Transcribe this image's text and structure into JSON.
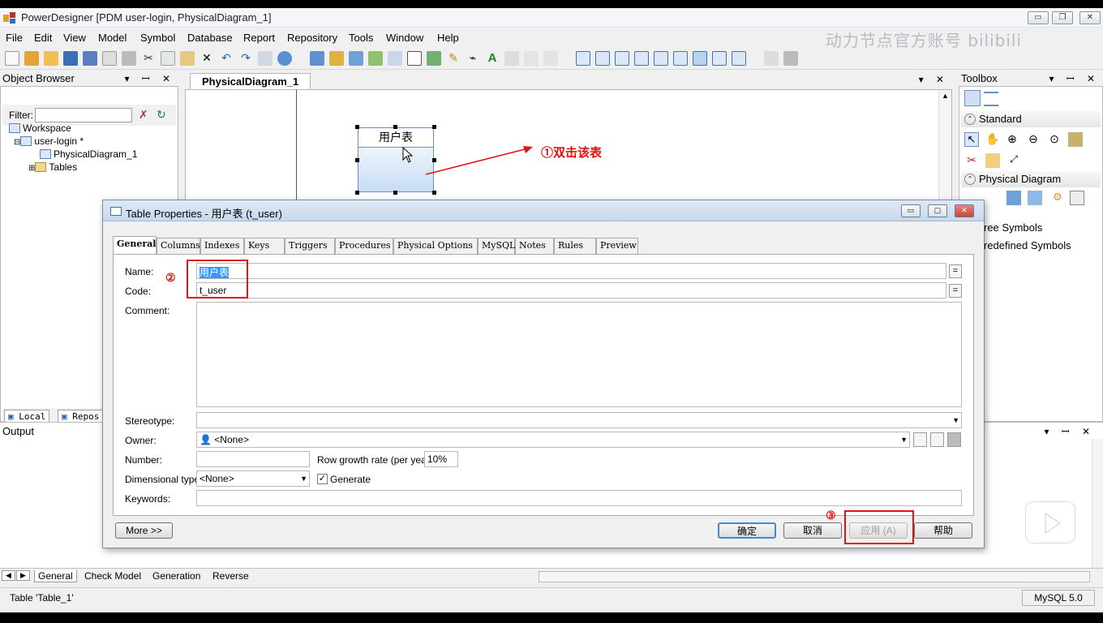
{
  "window": {
    "title": "PowerDesigner [PDM user-login, PhysicalDiagram_1]",
    "controls": [
      "▭",
      "❐",
      "✕"
    ]
  },
  "watermark": "动力节点官方账号 bilibili",
  "menu": [
    "File",
    "Edit",
    "View",
    "Model",
    "Symbol",
    "Database",
    "Report",
    "Repository",
    "Tools",
    "Window",
    "Help"
  ],
  "object_browser": {
    "title": "Object Browser",
    "filter_label": "Filter:",
    "tree": [
      "Workspace",
      "user-login *",
      "PhysicalDiagram_1",
      "Tables"
    ],
    "tabs": [
      "Local",
      "Repos"
    ]
  },
  "diagram": {
    "tab_label": "PhysicalDiagram_1",
    "table_symbol_name": "用户表",
    "annotation": "①双击该表"
  },
  "toolbox": {
    "title": "Toolbox",
    "sections": [
      "Standard",
      "Physical Diagram",
      "ree Symbols",
      "redefined Symbols"
    ]
  },
  "output": {
    "title": "Output",
    "tabs": [
      "General",
      "Check Model",
      "Generation",
      "Reverse"
    ]
  },
  "status": {
    "left": "Table 'Table_1'",
    "right": "MySQL 5.0"
  },
  "dialog": {
    "title": "Table Properties - 用户表 (t_user)",
    "tabs": [
      "General",
      "Columns",
      "Indexes",
      "Keys",
      "Triggers",
      "Procedures",
      "Physical Options",
      "MySQL",
      "Notes",
      "Rules",
      "Preview"
    ],
    "active_tab": "General",
    "labels": {
      "name": "Name:",
      "code": "Code:",
      "comment": "Comment:",
      "stereotype": "Stereotype:",
      "owner": "Owner:",
      "number": "Number:",
      "row_growth": "Row growth rate (per year):",
      "dimensional_type": "Dimensional type:",
      "generate": "Generate",
      "keywords": "Keywords:"
    },
    "values": {
      "name": "用户表",
      "code": "t_user",
      "owner": "<None>",
      "number": "",
      "row_growth": "10%",
      "dimensional_type": "<None>",
      "generate_checked": true
    },
    "annotations": {
      "step2": "②",
      "step3": "③"
    },
    "buttons": {
      "more": "More >>",
      "ok": "确定",
      "cancel": "取消",
      "apply": "应用 (A)",
      "help": "帮助"
    }
  },
  "colors": {
    "annotation_red": "#e01414",
    "selection_blue": "#3399ff",
    "table_symbol_fill": "#c8dcf4"
  }
}
